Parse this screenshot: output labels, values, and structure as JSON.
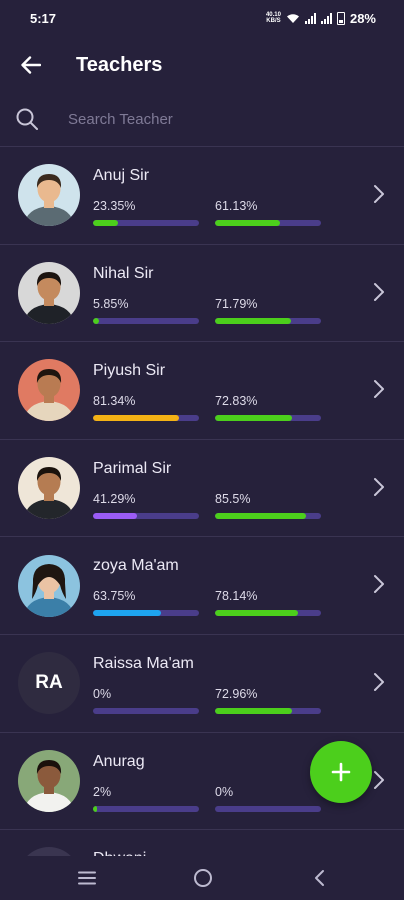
{
  "status_bar": {
    "time": "5:17",
    "net_speed_value": "40.10",
    "net_speed_unit": "KB/S",
    "battery": "28%"
  },
  "app_bar": {
    "title": "Teachers",
    "back_icon": "arrow-left-icon"
  },
  "search": {
    "placeholder": "Search Teacher",
    "value": "",
    "icon": "search-icon"
  },
  "teachers": [
    {
      "name": "Anuj Sir",
      "pct1_label": "23.35%",
      "pct1": 23.35,
      "pct1_color": "#4ccf1c",
      "pct2_label": "61.13%",
      "pct2": 61.13,
      "pct2_color": "#4ccf1c",
      "avatar": "photo"
    },
    {
      "name": "Nihal Sir",
      "pct1_label": "5.85%",
      "pct1": 5.85,
      "pct1_color": "#4ccf1c",
      "pct2_label": "71.79%",
      "pct2": 71.79,
      "pct2_color": "#4ccf1c",
      "avatar": "photo"
    },
    {
      "name": "Piyush Sir",
      "pct1_label": "81.34%",
      "pct1": 81.34,
      "pct1_color": "#f4b215",
      "pct2_label": "72.83%",
      "pct2": 72.83,
      "pct2_color": "#4ccf1c",
      "avatar": "photo"
    },
    {
      "name": "Parimal Sir",
      "pct1_label": "41.29%",
      "pct1": 41.29,
      "pct1_color": "#9b5cf6",
      "pct2_label": "85.5%",
      "pct2": 85.5,
      "pct2_color": "#4ccf1c",
      "avatar": "photo"
    },
    {
      "name": "zoya Ma'am",
      "pct1_label": "63.75%",
      "pct1": 63.75,
      "pct1_color": "#1ea4f0",
      "pct2_label": "78.14%",
      "pct2": 78.14,
      "pct2_color": "#4ccf1c",
      "avatar": "photo"
    },
    {
      "name": "Raissa Ma'am",
      "pct1_label": "0%",
      "pct1": 0,
      "pct1_color": "#4ccf1c",
      "pct2_label": "72.96%",
      "pct2": 72.96,
      "pct2_color": "#4ccf1c",
      "avatar": "initials",
      "initials": "RA"
    },
    {
      "name": "Anurag",
      "pct1_label": "2%",
      "pct1": 2,
      "pct1_color": "#4ccf1c",
      "pct2_label": "0%",
      "pct2": 0,
      "pct2_color": "#4ccf1c",
      "avatar": "photo"
    },
    {
      "name": "Dhwani",
      "pct1_label": "",
      "pct1": 0,
      "pct1_color": "#4ccf1c",
      "pct2_label": "",
      "pct2": 0,
      "pct2_color": "#4ccf1c",
      "avatar": "photo"
    }
  ],
  "fab": {
    "icon": "plus-icon"
  },
  "nav_bar": {
    "recent": "menu-icon",
    "home": "home-circle-icon",
    "back": "back-chevron-icon"
  },
  "colors": {
    "background": "#26213b",
    "track": "#4a3d8a",
    "divider": "#3a3452",
    "accent_green": "#4ccf1c"
  }
}
